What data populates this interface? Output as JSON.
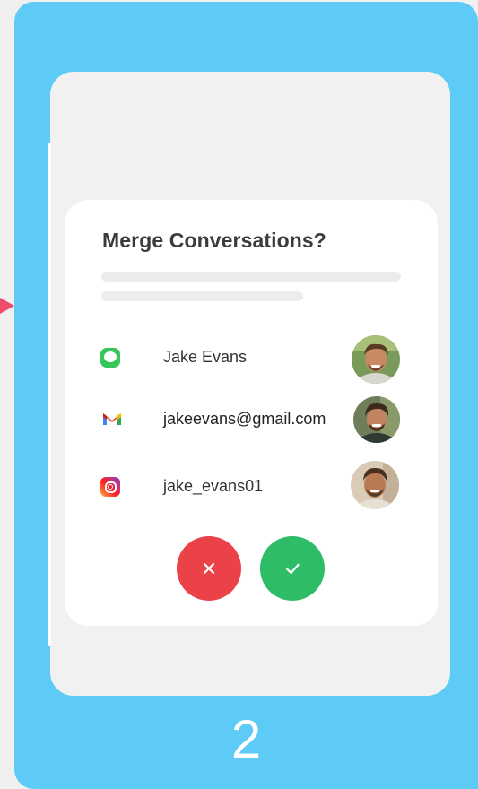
{
  "dialog": {
    "title": "Merge Conversations?"
  },
  "contacts": [
    {
      "app_icon": "messages-icon",
      "text": "Jake Evans"
    },
    {
      "app_icon": "gmail-icon",
      "text": "jakeevans@gmail.com"
    },
    {
      "app_icon": "instagram-icon",
      "text": "jake_evans01"
    }
  ],
  "buttons": {
    "cancel_icon": "close-icon",
    "confirm_icon": "checkmark-icon"
  },
  "step": {
    "number": "2"
  },
  "colors": {
    "frame_background": "#5ecbf6",
    "pointer": "#ef4b6c",
    "cancel": "#eb4149",
    "confirm": "#2ebc67",
    "messages_green": "#35c759"
  }
}
